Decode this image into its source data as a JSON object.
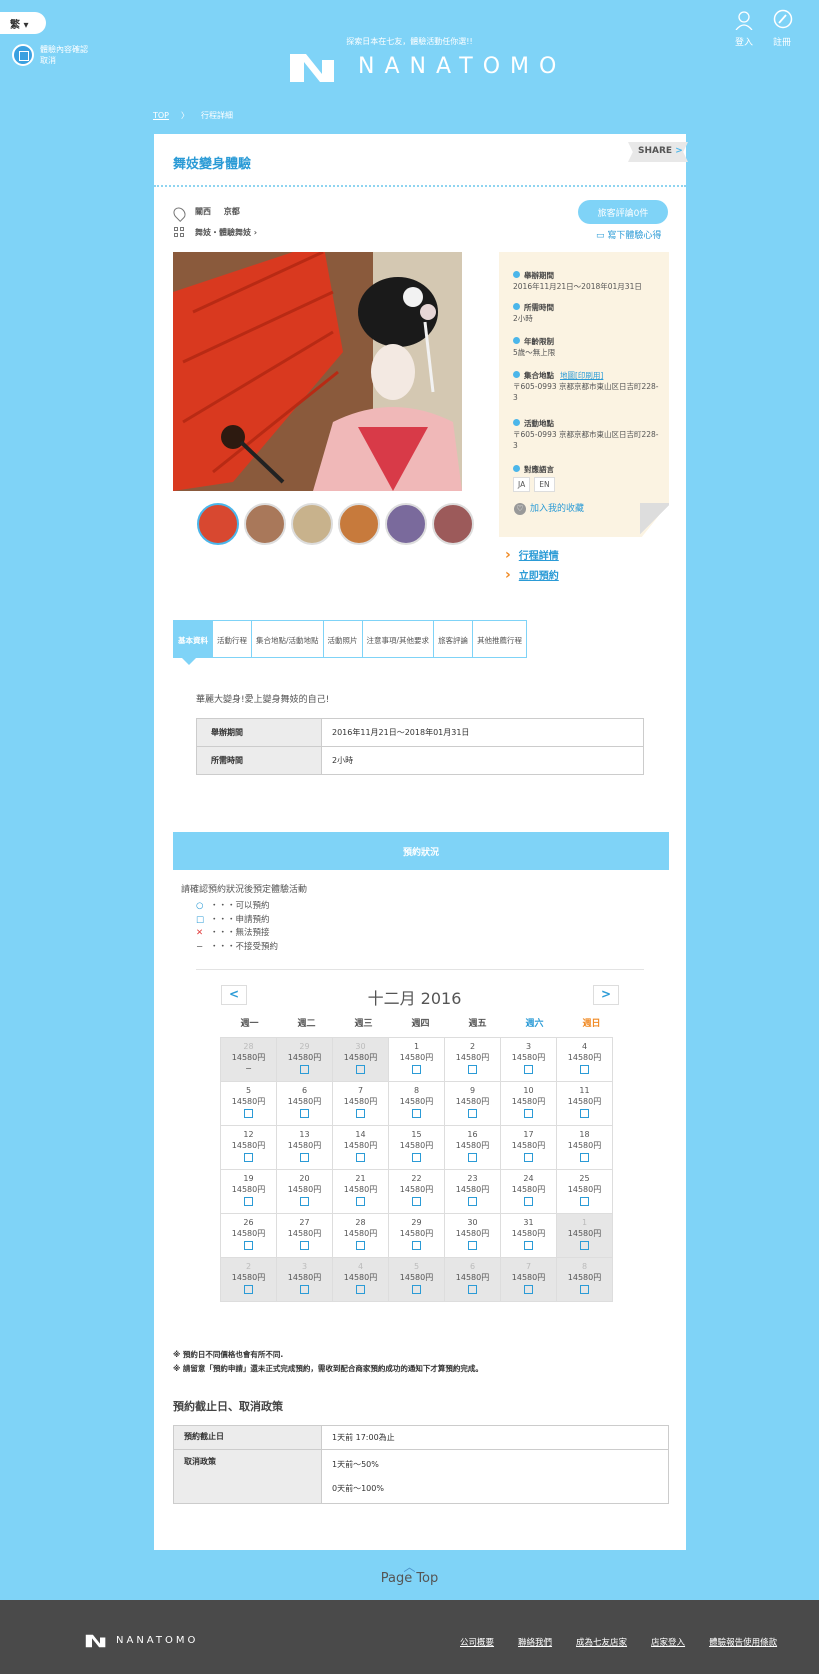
{
  "header": {
    "lang": "繁",
    "cal_line1": "體驗內容確認",
    "cal_line2": "取消",
    "tagline": "探索日本在七友，體驗活動任你選!!",
    "logo_text": "NANATOMO",
    "login": "登入",
    "register": "註冊"
  },
  "breadcrumb": {
    "top": "TOP",
    "current": "行程詳細"
  },
  "page": {
    "title": "舞妓變身體驗",
    "share": "SHARE",
    "location": "關西 京都",
    "category": "舞妓・體驗舞妓",
    "review_btn": "旅客評論0件",
    "write_review": "寫下體驗心得"
  },
  "info": {
    "period_h": "舉辦期間",
    "period_v": "2016年11月21日～2018年01月31日",
    "duration_h": "所需時間",
    "duration_v": "2小時",
    "age_h": "年齡限制",
    "age_v": "5歲～無上限",
    "meet_h": "集合地點",
    "meet_link": "地圖[印刷用]",
    "meet_v": "〒605-0993 京都京都市東山区日吉町228-3",
    "act_h": "活動地點",
    "act_v": "〒605-0993 京都京都市東山区日吉町228-3",
    "lang_h": "對應語言",
    "langs": [
      "JA",
      "EN"
    ],
    "fav": "加入我的收藏"
  },
  "links": {
    "detail": "行程詳情",
    "book": "立即預約"
  },
  "tabs": [
    "基本資料",
    "活動行程",
    "集合地點/活動地點",
    "活動照片",
    "注意事項/其他要求",
    "旅客評論",
    "其他推薦行程"
  ],
  "basic": {
    "intro": "華麗大變身!愛上變身舞妓的自己!",
    "rows": [
      {
        "k": "舉辦期間",
        "v": "2016年11月21日～2018年01月31日"
      },
      {
        "k": "所需時間",
        "v": "2小時"
      }
    ]
  },
  "booking": {
    "header": "預約狀況",
    "desc": "請確認預約狀況後預定體驗活動",
    "legend": [
      {
        "sym": "○",
        "text": "・・・可以預約",
        "color": "#2b9bd6"
      },
      {
        "sym": "□",
        "text": "・・・申請預約",
        "color": "#2b9bd6"
      },
      {
        "sym": "✕",
        "text": "・・・無法預接",
        "color": "#e23b3b"
      },
      {
        "sym": "−",
        "text": "・・・不接受預約",
        "color": "#555555"
      }
    ],
    "prev": "<",
    "next": ">",
    "month_title": "十二月 2016",
    "dow": [
      "週一",
      "週二",
      "週三",
      "週四",
      "週五",
      "週六",
      "週日"
    ],
    "price": "14580円",
    "weeks": [
      [
        "28",
        "29",
        "30",
        "1",
        "2",
        "3",
        "4"
      ],
      [
        "5",
        "6",
        "7",
        "8",
        "9",
        "10",
        "11"
      ],
      [
        "12",
        "13",
        "14",
        "15",
        "16",
        "17",
        "18"
      ],
      [
        "19",
        "20",
        "21",
        "22",
        "23",
        "24",
        "25"
      ],
      [
        "26",
        "27",
        "28",
        "29",
        "30",
        "31",
        "1"
      ],
      [
        "2",
        "3",
        "4",
        "5",
        "6",
        "7",
        "8"
      ]
    ]
  },
  "notes": [
    "※ 預約日不同價格也會有所不同.",
    "※ 請留意「預約申請」還未正式完成預約，需收到配合商家預約成功的通知下才算預約完成。"
  ],
  "policy": {
    "heading": "預約截止日、取消政策",
    "deadline_k": "預約截止日",
    "deadline_v": "1天前 17:00為止",
    "cancel_k": "取消政策",
    "cancel_v1": "1天前～50%",
    "cancel_v2": "0天前～100%"
  },
  "footer": {
    "page_top": "Page Top",
    "logo_text": "NANATOMO",
    "links": [
      "公司概要",
      "聯絡我們",
      "成為七友店家",
      "店家登入",
      "體驗報告使用條款"
    ]
  }
}
